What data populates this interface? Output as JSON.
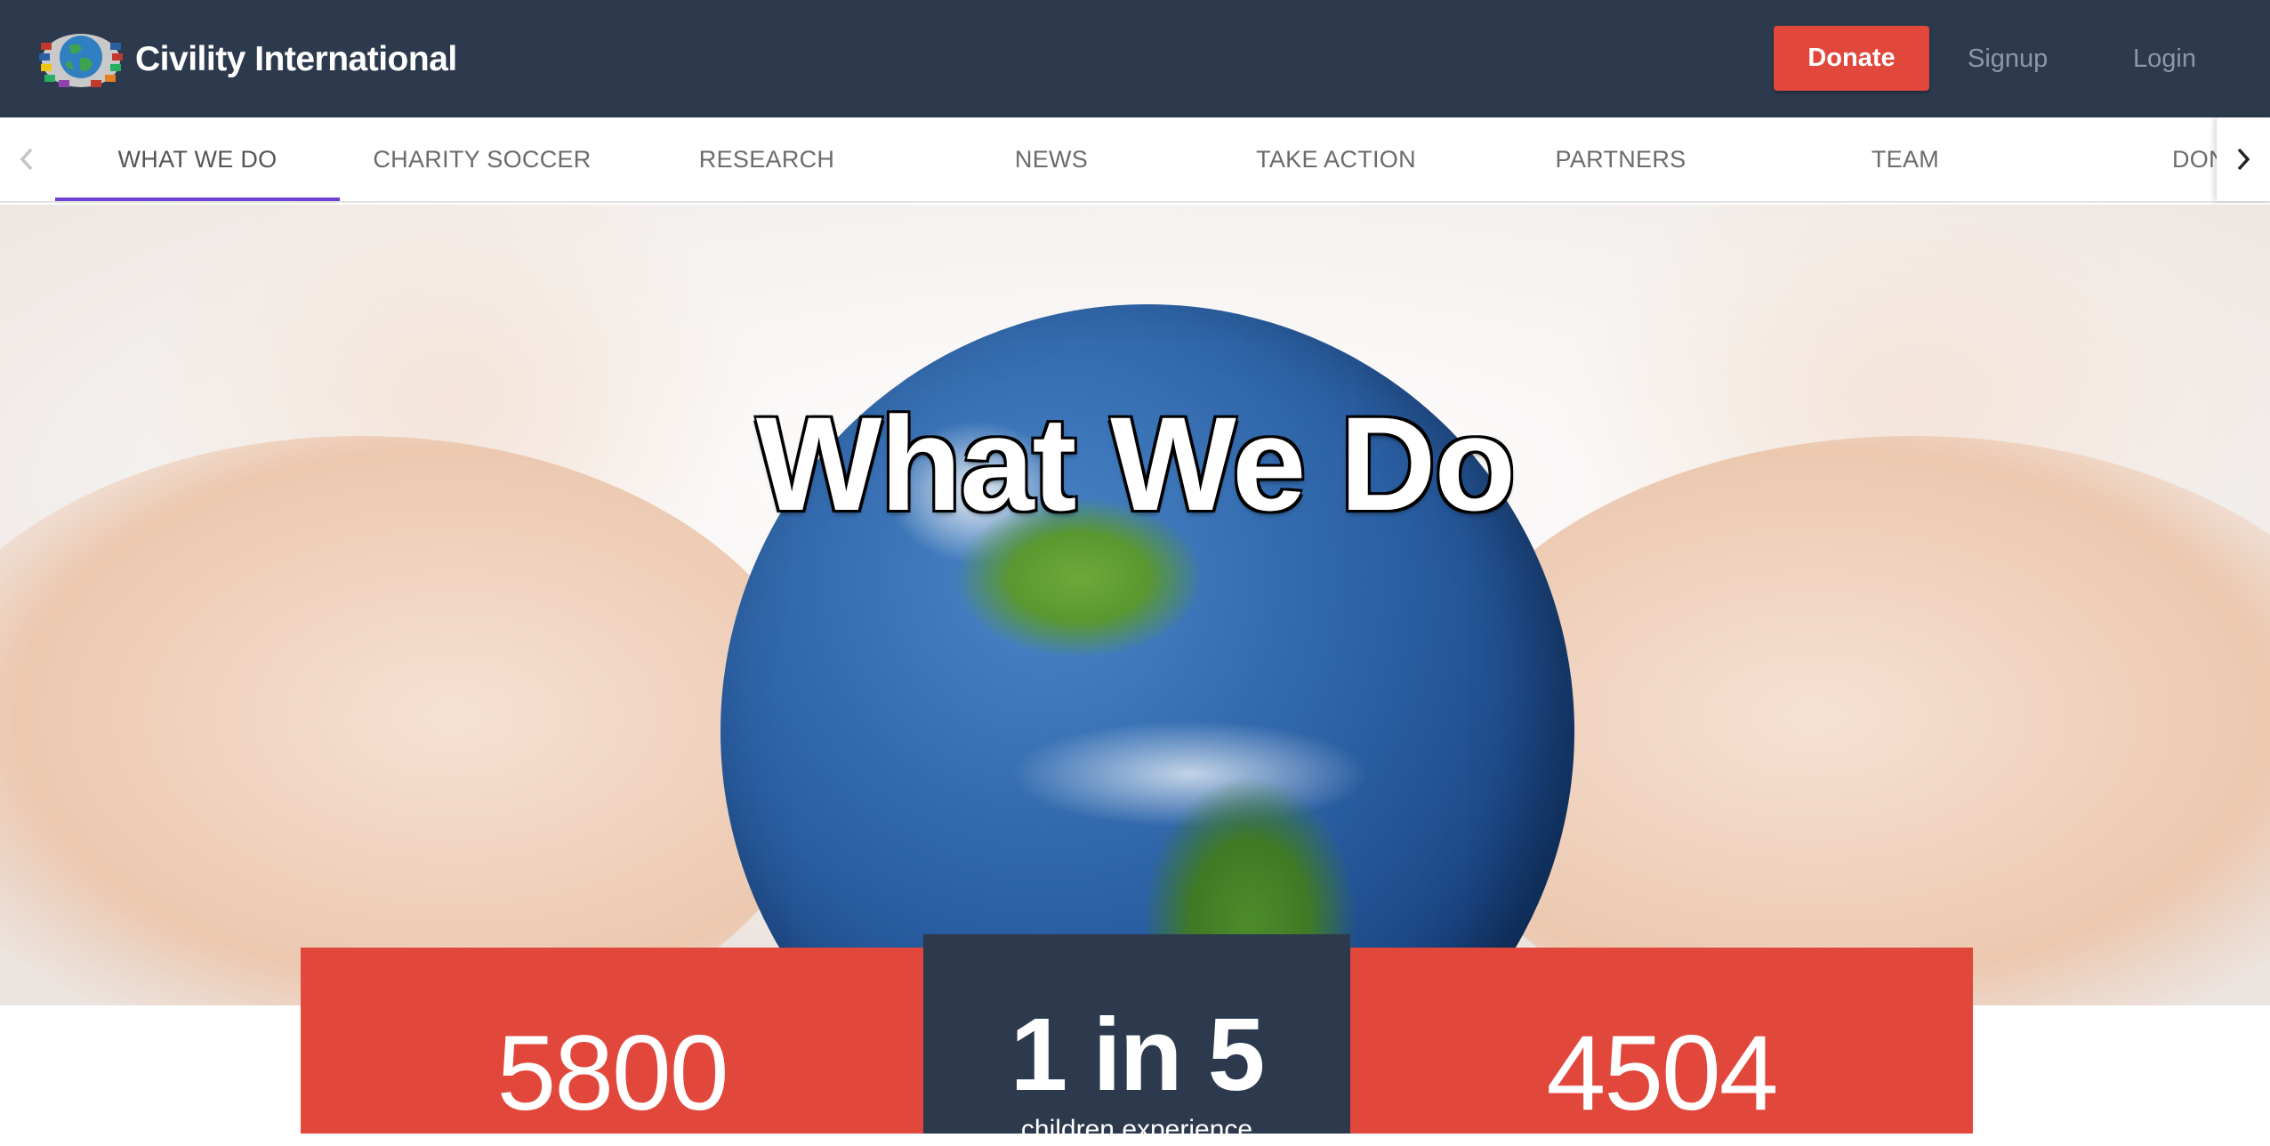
{
  "header": {
    "brand": "Civility International",
    "donate_label": "Donate",
    "signup_label": "Signup",
    "login_label": "Login"
  },
  "tabs": [
    {
      "label": "WHAT WE DO",
      "active": true
    },
    {
      "label": "CHARITY SOCCER"
    },
    {
      "label": "RESEARCH"
    },
    {
      "label": "NEWS"
    },
    {
      "label": "TAKE ACTION"
    },
    {
      "label": "PARTNERS"
    },
    {
      "label": "TEAM"
    },
    {
      "label": "DONATIO"
    }
  ],
  "hero": {
    "title": "What We Do"
  },
  "stats": [
    {
      "value": "5800",
      "caption": ""
    },
    {
      "value": "1 in 5",
      "caption": "children experience"
    },
    {
      "value": "4504",
      "caption": ""
    }
  ],
  "colors": {
    "header_bg": "#2d3a4d",
    "accent_red": "#e2473c",
    "tab_underline": "#6f3fcf"
  }
}
